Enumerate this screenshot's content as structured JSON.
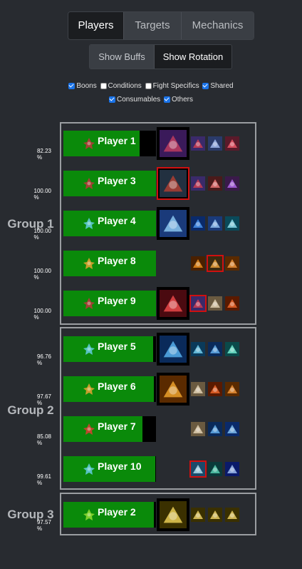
{
  "tabs": [
    {
      "label": "Players",
      "active": true
    },
    {
      "label": "Targets",
      "active": false
    },
    {
      "label": "Mechanics",
      "active": false
    }
  ],
  "toggles": {
    "show_buffs": "Show Buffs",
    "show_rotation": "Show Rotation",
    "active": "show_rotation"
  },
  "filters": {
    "row1": [
      {
        "label": "Boons",
        "checked": true
      },
      {
        "label": "Conditions",
        "checked": false
      },
      {
        "label": "Fight Specifics",
        "checked": false
      },
      {
        "label": "Shared",
        "checked": true
      }
    ],
    "row2": [
      {
        "label": "Consumables",
        "checked": true
      },
      {
        "label": "Others",
        "checked": true
      }
    ]
  },
  "groups": [
    {
      "label": "Group 1",
      "players": [
        {
          "name": "Player 1",
          "percent": "82.23 %",
          "fill": 0.8223,
          "class_icon": "reaper-icon",
          "class_color": "#b33a3a",
          "skill_icon": "purple-demon-skill-icon",
          "skill_selected": false,
          "buffs": [
            {
              "icon": "red-blue-skill-icon",
              "sel": false
            },
            {
              "icon": "blue-dagger-skill-icon",
              "sel": false
            },
            {
              "icon": "red-slash-skill-icon",
              "sel": false
            }
          ]
        },
        {
          "name": "Player 3",
          "percent": "100.00 %",
          "fill": 1.0,
          "class_icon": "reaper-icon",
          "class_color": "#b33a3a",
          "skill_icon": "dark-arrow-skill-icon",
          "skill_selected": true,
          "buffs": [
            {
              "icon": "red-blue-skill-icon",
              "sel": false
            },
            {
              "icon": "cross-target-skill-icon",
              "sel": false
            },
            {
              "icon": "purple-glyph-skill-icon",
              "sel": false
            }
          ]
        },
        {
          "name": "Player 4",
          "percent": "100.00 %",
          "fill": 1.0,
          "class_icon": "tempest-icon",
          "class_color": "#5fc9d6",
          "skill_icon": "blue-mage-skill-icon",
          "skill_selected": false,
          "buffs": [
            {
              "icon": "blue-vortex-skill-icon",
              "sel": false
            },
            {
              "icon": "blue-wind-skill-icon",
              "sel": false
            },
            {
              "icon": "cyan-sword-skill-icon",
              "sel": false
            }
          ]
        },
        {
          "name": "Player 8",
          "percent": "100.00 %",
          "fill": 1.0,
          "class_icon": "firebrand-icon",
          "class_color": "#d9a030",
          "skill_icon": "",
          "skill_selected": false,
          "buffs": [
            {
              "icon": "orange-spark-skill-icon",
              "sel": false
            },
            {
              "icon": "flame-sword-skill-icon",
              "sel": true
            },
            {
              "icon": "orange-burst-skill-icon",
              "sel": false
            }
          ]
        },
        {
          "name": "Player 9",
          "percent": "100.00 %",
          "fill": 1.0,
          "class_icon": "reaper-icon",
          "class_color": "#b33a3a",
          "skill_icon": "red-pillar-skill-icon",
          "skill_selected": false,
          "buffs": [
            {
              "icon": "red-blue-skill-icon",
              "sel": true
            },
            {
              "icon": "cycle-skill-icon",
              "sel": false
            },
            {
              "icon": "orange-orb-skill-icon",
              "sel": false
            }
          ]
        }
      ]
    },
    {
      "label": "Group 2",
      "players": [
        {
          "name": "Player 5",
          "percent": "96.76 %",
          "fill": 0.9676,
          "class_icon": "weaver-icon",
          "class_color": "#5fc9d6",
          "skill_icon": "blue-slash-skill-icon",
          "skill_selected": false,
          "buffs": [
            {
              "icon": "blue-shard-skill-icon",
              "sel": false
            },
            {
              "icon": "blue-streak-skill-icon",
              "sel": false
            },
            {
              "icon": "teal-leaf-skill-icon",
              "sel": false
            }
          ]
        },
        {
          "name": "Player 6",
          "percent": "97.67 %",
          "fill": 0.9767,
          "class_icon": "firebrand-icon",
          "class_color": "#d9a030",
          "skill_icon": "fire-strike-skill-icon",
          "skill_selected": false,
          "buffs": [
            {
              "icon": "cycle-skill-icon",
              "sel": false
            },
            {
              "icon": "orange-orb-skill-icon",
              "sel": false
            },
            {
              "icon": "orange-burst-skill-icon",
              "sel": false
            }
          ]
        },
        {
          "name": "Player 7",
          "percent": "85.08 %",
          "fill": 0.8508,
          "class_icon": "renegade-icon",
          "class_color": "#d04030",
          "skill_icon": "",
          "skill_selected": false,
          "buffs": [
            {
              "icon": "cycle-skill-icon",
              "sel": false
            },
            {
              "icon": "blue-streak-skill-icon",
              "sel": false
            },
            {
              "icon": "blue-wave-skill-icon",
              "sel": false
            }
          ]
        },
        {
          "name": "Player 10",
          "percent": "99.61 %",
          "fill": 0.9961,
          "class_icon": "tempest-icon",
          "class_color": "#5fc9d6",
          "skill_icon": "",
          "skill_selected": false,
          "buffs": [
            {
              "icon": "ice-shard-skill-icon",
              "sel": true
            },
            {
              "icon": "teal-figure-skill-icon",
              "sel": false
            },
            {
              "icon": "blue-pillar-skill-icon",
              "sel": false
            }
          ]
        }
      ]
    },
    {
      "label": "Group 3",
      "players": [
        {
          "name": "Player 2",
          "percent": "97.57 %",
          "fill": 0.9757,
          "class_icon": "druid-icon",
          "class_color": "#8bd630",
          "skill_icon": "golden-feather-skill-icon",
          "skill_selected": false,
          "buffs": [
            {
              "icon": "gold-feather-skill-icon",
              "sel": false
            },
            {
              "icon": "gold-feather-skill-icon",
              "sel": false
            },
            {
              "icon": "gold-feather-skill-icon",
              "sel": false
            }
          ]
        }
      ]
    }
  ]
}
